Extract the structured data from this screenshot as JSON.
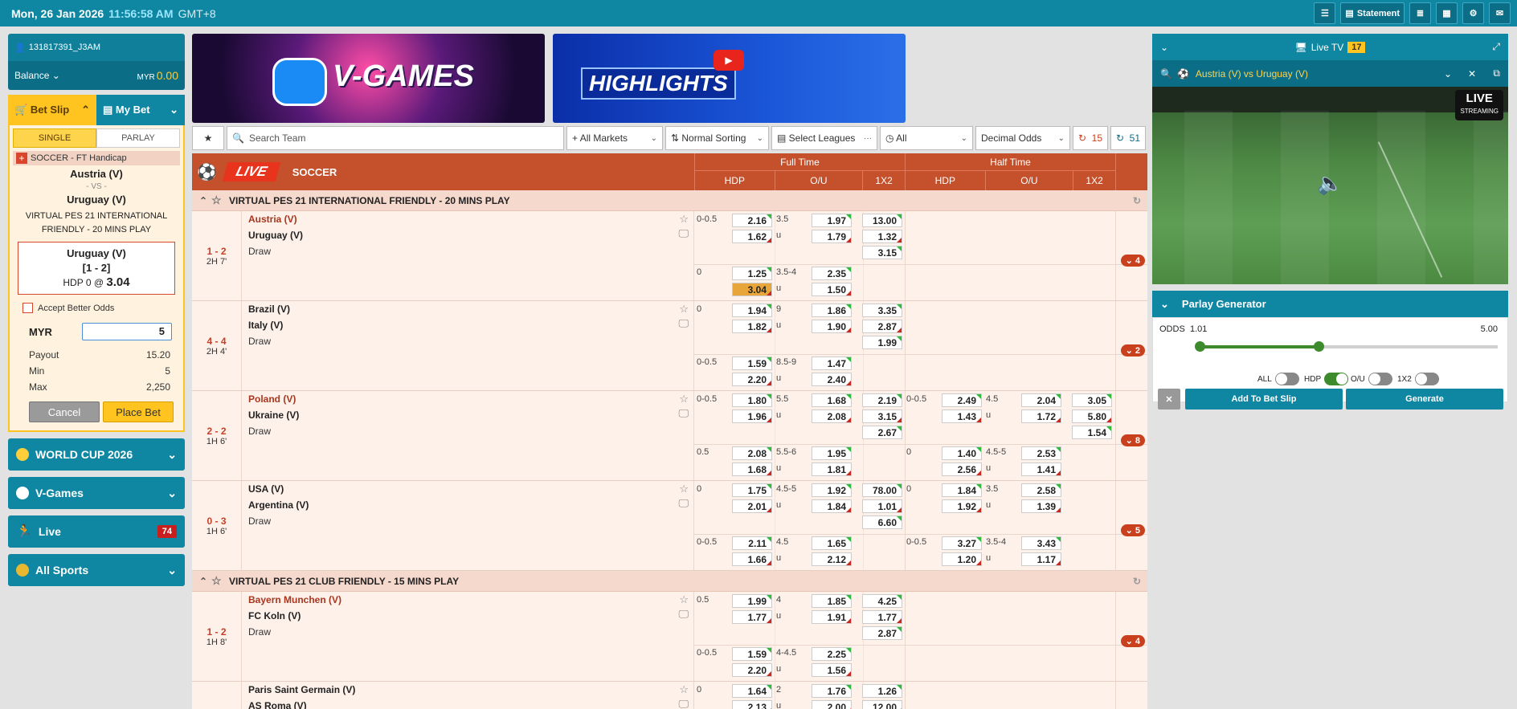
{
  "topbar": {
    "date": "Mon, 26 Jan 2026",
    "time": "11:56:58 AM",
    "tz": "GMT+8",
    "statement": "Statement"
  },
  "account": {
    "username": "131817391_J3AM",
    "balance_label": "Balance",
    "currency": "MYR",
    "amount": "0.00"
  },
  "betslip": {
    "tab_betslip": "Bet Slip",
    "tab_mybet": "My Bet",
    "single": "SINGLE",
    "parlay": "PARLAY",
    "market": "SOCCER - FT Handicap",
    "home": "Austria (V)",
    "vs": "- VS -",
    "away": "Uruguay (V)",
    "league": "VIRTUAL PES 21 INTERNATIONAL FRIENDLY - 20 MINS PLAY",
    "pick_team": "Uruguay (V)",
    "pick_score": "[1 - 2]",
    "pick_line": "HDP 0 @",
    "pick_odds": "3.04",
    "accept_better": "Accept Better Odds",
    "stake_currency": "MYR",
    "stake_value": "5",
    "payout_label": "Payout",
    "payout": "15.20",
    "min_label": "Min",
    "min": "5",
    "max_label": "Max",
    "max": "2,250",
    "cancel": "Cancel",
    "place": "Place Bet"
  },
  "nav": [
    {
      "label": "WORLD CUP 2026",
      "icon": "trophy-icon"
    },
    {
      "label": "V-Games",
      "icon": "vgames-icon"
    },
    {
      "label": "Live",
      "icon": "running-icon",
      "badge": "74"
    },
    {
      "label": "All Sports",
      "icon": "sports-icon"
    }
  ],
  "banners": {
    "vgames": "V-GAMES",
    "highlights": "HIGHLIGHTS"
  },
  "filters": {
    "search_placeholder": "Search Team",
    "markets": "All Markets",
    "sorting": "Normal Sorting",
    "leagues": "Select Leagues",
    "time": "All",
    "odds": "Decimal Odds",
    "refresh1": "15",
    "refresh2": "51"
  },
  "table": {
    "live": "LIVE",
    "sport": "SOCCER",
    "full_time": "Full Time",
    "half_time": "Half Time",
    "hdp": "HDP",
    "ou": "O/U",
    "x12": "1X2"
  },
  "leagues": [
    {
      "name": "VIRTUAL PES 21 INTERNATIONAL FRIENDLY - 20 MINS PLAY",
      "matches": [
        {
          "score": "1 - 2",
          "time": "2H 7'",
          "home": "Austria (V)",
          "away": "Uruguay (V)",
          "draw": "Draw",
          "home_red": true,
          "more": "4",
          "rows": [
            {
              "ft_hdp_line": "0-0.5",
              "ft_hdp": [
                "2.16",
                "1.62"
              ],
              "ft_ou_line": "3.5",
              "ft_ou": [
                "1.97",
                "1.79"
              ],
              "ft_1x2": [
                "13.00",
                "1.32",
                "3.15"
              ]
            },
            {
              "ft_hdp_line": "0",
              "ft_hdp": [
                "1.25",
                "3.04"
              ],
              "ft_ou_line": "3.5-4",
              "ft_ou": [
                "2.35",
                "1.50"
              ]
            }
          ]
        },
        {
          "score": "4 - 4",
          "time": "2H 4'",
          "home": "Brazil (V)",
          "away": "Italy (V)",
          "draw": "Draw",
          "more": "2",
          "rows": [
            {
              "ft_hdp_line": "0",
              "ft_hdp": [
                "1.94",
                "1.82"
              ],
              "ft_ou_line": "9",
              "ft_ou": [
                "1.86",
                "1.90"
              ],
              "ft_1x2": [
                "3.35",
                "2.87",
                "1.99"
              ]
            },
            {
              "ft_hdp_line": "0-0.5",
              "ft_hdp": [
                "1.59",
                "2.20"
              ],
              "ft_ou_line": "8.5-9",
              "ft_ou": [
                "1.47",
                "2.40"
              ]
            }
          ]
        },
        {
          "score": "2 - 2",
          "time": "1H 6'",
          "home": "Poland (V)",
          "away": "Ukraine (V)",
          "draw": "Draw",
          "home_red": true,
          "more": "8",
          "rows": [
            {
              "ft_hdp_line": "0-0.5",
              "ft_hdp": [
                "1.80",
                "1.96"
              ],
              "ft_ou_line": "5.5",
              "ft_ou": [
                "1.68",
                "2.08"
              ],
              "ft_1x2": [
                "2.19",
                "3.15",
                "2.67"
              ],
              "ht_hdp_line": "0-0.5",
              "ht_hdp": [
                "2.49",
                "1.43"
              ],
              "ht_ou_line": "4.5",
              "ht_ou": [
                "2.04",
                "1.72"
              ],
              "ht_1x2": [
                "3.05",
                "5.80",
                "1.54"
              ]
            },
            {
              "ft_hdp_line": "0.5",
              "ft_hdp": [
                "2.08",
                "1.68"
              ],
              "ft_ou_line": "5.5-6",
              "ft_ou": [
                "1.95",
                "1.81"
              ],
              "ht_hdp_line": "0",
              "ht_hdp": [
                "1.40",
                "2.56"
              ],
              "ht_ou_line": "4.5-5",
              "ht_ou": [
                "2.53",
                "1.41"
              ]
            }
          ]
        },
        {
          "score": "0 - 3",
          "time": "1H 6'",
          "home": "USA (V)",
          "away": "Argentina (V)",
          "draw": "Draw",
          "more": "5",
          "rows": [
            {
              "ft_hdp_line": "0",
              "ft_hdp": [
                "1.75",
                "2.01"
              ],
              "ft_ou_line": "4.5-5",
              "ft_ou": [
                "1.92",
                "1.84"
              ],
              "ft_1x2": [
                "78.00",
                "1.01",
                "6.60"
              ],
              "ht_hdp_line": "0",
              "ht_hdp": [
                "1.84",
                "1.92"
              ],
              "ht_ou_line": "3.5",
              "ht_ou": [
                "2.58",
                "1.39"
              ]
            },
            {
              "ft_hdp_line": "0-0.5",
              "ft_hdp": [
                "2.11",
                "1.66"
              ],
              "ft_ou_line": "4.5",
              "ft_ou": [
                "1.65",
                "2.12"
              ],
              "ht_hdp_line": "0-0.5",
              "ht_hdp": [
                "3.27",
                "1.20"
              ],
              "ht_ou_line": "3.5-4",
              "ht_ou": [
                "3.43",
                "1.17"
              ]
            }
          ]
        }
      ]
    },
    {
      "name": "VIRTUAL PES 21 CLUB FRIENDLY - 15 MINS PLAY",
      "matches": [
        {
          "score": "1 - 2",
          "time": "1H 8'",
          "home": "Bayern Munchen (V)",
          "away": "FC Koln (V)",
          "draw": "Draw",
          "home_red": true,
          "more": "4",
          "rows": [
            {
              "ft_hdp_line": "0.5",
              "ft_hdp": [
                "1.99",
                "1.77"
              ],
              "ft_ou_line": "4",
              "ft_ou": [
                "1.85",
                "1.91"
              ],
              "ft_1x2": [
                "4.25",
                "1.77",
                "2.87"
              ]
            },
            {
              "ft_hdp_line": "0-0.5",
              "ft_hdp": [
                "1.59",
                "2.20"
              ],
              "ft_ou_line": "4-4.5",
              "ft_ou": [
                "2.25",
                "1.56"
              ]
            }
          ]
        },
        {
          "score": "",
          "time": "",
          "home": "Paris Saint Germain (V)",
          "away": "AS Roma (V)",
          "draw": "",
          "more": "",
          "rows": [
            {
              "ft_hdp_line": "0",
              "ft_hdp": [
                "1.64",
                "2.13"
              ],
              "ft_ou_line": "2",
              "ft_ou": [
                "1.76",
                "2.00"
              ],
              "ft_1x2": [
                "1.26",
                "12.00"
              ]
            }
          ]
        }
      ]
    }
  ],
  "tv": {
    "title": "Live TV",
    "count": "17",
    "match": "Austria (V) vs Uruguay (V)",
    "live": "LIVE",
    "streaming": "STREAMING"
  },
  "parlay": {
    "title": "Parlay Generator",
    "odds_label": "ODDS",
    "min": "1.01",
    "max": "5.00",
    "level_low": 0,
    "level_high": 0.4,
    "toggles": [
      {
        "label": "ALL",
        "on": false
      },
      {
        "label": "HDP",
        "on": true
      },
      {
        "label": "O/U",
        "on": false
      },
      {
        "label": "1X2",
        "on": false
      }
    ],
    "add": "Add To Bet Slip",
    "generate": "Generate"
  }
}
